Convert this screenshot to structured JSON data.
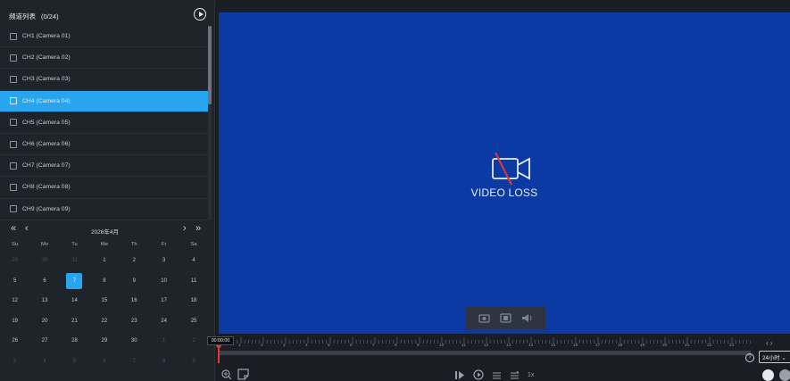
{
  "channel_panel": {
    "title": "频道列表",
    "count": "(0/24)",
    "items": [
      {
        "label": "CH1 (Camera 01)",
        "selected": false
      },
      {
        "label": "CH2 (Camera 02)",
        "selected": false
      },
      {
        "label": "CH3 (Camera 03)",
        "selected": false
      },
      {
        "label": "CH4 (Camera 04)",
        "selected": true
      },
      {
        "label": "CH5 (Camera 05)",
        "selected": false
      },
      {
        "label": "CH6 (Camera 06)",
        "selected": false
      },
      {
        "label": "CH7 (Camera 07)",
        "selected": false
      },
      {
        "label": "CH8 (Camera 08)",
        "selected": false
      },
      {
        "label": "CH9 (Camera 09)",
        "selected": false
      }
    ]
  },
  "calendar": {
    "title": "2026年4月",
    "weekdays": [
      "Su",
      "Mo",
      "Tu",
      "We",
      "Th",
      "Fr",
      "Sa"
    ],
    "days": [
      {
        "d": "29",
        "dim": true
      },
      {
        "d": "30",
        "dim": true
      },
      {
        "d": "31",
        "dim": true
      },
      {
        "d": "1"
      },
      {
        "d": "2"
      },
      {
        "d": "3"
      },
      {
        "d": "4"
      },
      {
        "d": "5"
      },
      {
        "d": "6"
      },
      {
        "d": "7",
        "selected": true
      },
      {
        "d": "8"
      },
      {
        "d": "9"
      },
      {
        "d": "10"
      },
      {
        "d": "11"
      },
      {
        "d": "12"
      },
      {
        "d": "13"
      },
      {
        "d": "14"
      },
      {
        "d": "15"
      },
      {
        "d": "16"
      },
      {
        "d": "17"
      },
      {
        "d": "18"
      },
      {
        "d": "19"
      },
      {
        "d": "20"
      },
      {
        "d": "21"
      },
      {
        "d": "22"
      },
      {
        "d": "23"
      },
      {
        "d": "24"
      },
      {
        "d": "25"
      },
      {
        "d": "26"
      },
      {
        "d": "27"
      },
      {
        "d": "28"
      },
      {
        "d": "29"
      },
      {
        "d": "30"
      },
      {
        "d": "1",
        "dim": true
      },
      {
        "d": "2",
        "dim": true
      },
      {
        "d": "3",
        "dim": true
      },
      {
        "d": "4",
        "dim": true
      },
      {
        "d": "5",
        "dim": true
      },
      {
        "d": "6",
        "dim": true
      },
      {
        "d": "7",
        "dim": true
      },
      {
        "d": "8",
        "dim": true
      },
      {
        "d": "9",
        "dim": true
      }
    ]
  },
  "video": {
    "status_text": "VIDEO LOSS",
    "background": "#0b3aa4",
    "toolbar_icons": [
      "snapshot-icon",
      "clip-icon",
      "volume-icon"
    ]
  },
  "timeline": {
    "current_time": "00:00:00",
    "hour_labels": [
      "1",
      "2",
      "3",
      "4",
      "5",
      "6",
      "7",
      "8",
      "9",
      "10",
      "11",
      "12",
      "13",
      "14",
      "15",
      "16",
      "17",
      "18",
      "19",
      "20",
      "21",
      "22",
      "23",
      "24"
    ],
    "scale_label": "24小时",
    "speed": "1x"
  },
  "colors": {
    "accent": "#29a4ee",
    "cursor": "#e8392f"
  }
}
